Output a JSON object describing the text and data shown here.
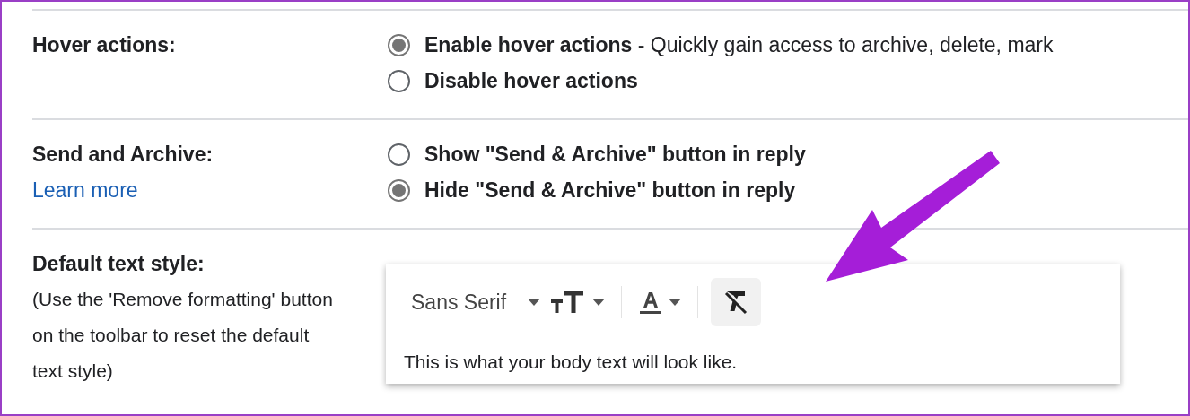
{
  "settings": [
    {
      "kind": "radio",
      "label": "Hover actions:",
      "options": [
        {
          "text": "**Enable hover actions** - Quickly gain access to archive, delete, mark",
          "selected": true
        },
        {
          "text": "Disable hover actions",
          "selected": false
        }
      ]
    },
    {
      "kind": "radio",
      "label": "Send and Archive:",
      "link": "Learn more",
      "options": [
        {
          "text": "Show \"Send & Archive\" button in reply",
          "selected": false
        },
        {
          "text": "Hide \"Send & Archive\" button in reply",
          "selected": true
        }
      ]
    },
    {
      "kind": "text_style",
      "label": "Default text style:",
      "description": "(Use the 'Remove formatting' button on the toolbar to reset the default text style)",
      "toolbar": {
        "font": "Sans Serif",
        "remove_formatting_highlighted": true
      },
      "sample": "This is what your body text will look like."
    }
  ],
  "annotation": {
    "kind": "arrow",
    "color": "#a51ed8"
  }
}
